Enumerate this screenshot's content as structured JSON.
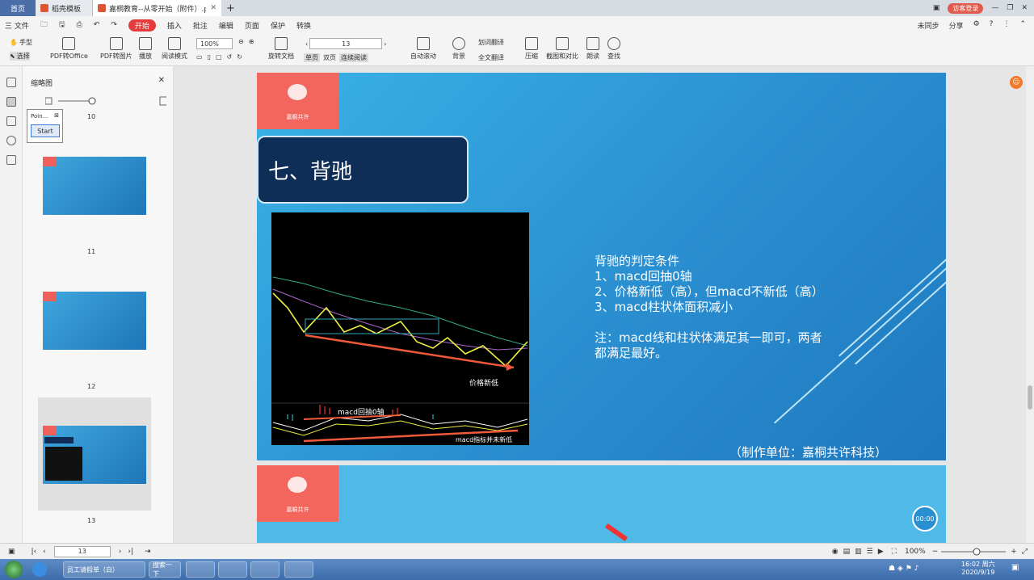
{
  "tabs": {
    "home": "首页",
    "t1": "稻壳模板",
    "t2": "嘉桐教育--从零开始（附件）.pdf"
  },
  "window": {
    "login": "访客登录"
  },
  "menu": {
    "file": "三 文件",
    "start": "开始",
    "insert": "插入",
    "annotate": "批注",
    "edit": "编辑",
    "page": "页面",
    "protect": "保护",
    "convert": "转换",
    "sync": "未同步",
    "share": "分享"
  },
  "toolbar": {
    "hand": "手型",
    "select": "选择",
    "pdf2office": "PDF转Office",
    "pdf2img": "PDF转图片",
    "play": "播放",
    "read": "阅读模式",
    "zoom": "100%",
    "rotate": "旋转文档",
    "page": "13",
    "single": "单页",
    "double": "双页",
    "continuous": "连续阅读",
    "autoscroll": "自动滚动",
    "bg": "背景",
    "translate": "划词翻译",
    "fulltrans": "全文翻译",
    "compress": "压缩",
    "screenshot": "截图和对比",
    "read2": "朗读",
    "find": "查找"
  },
  "panel": {
    "title": "缩略图",
    "pages": [
      "10",
      "11",
      "12",
      "13"
    ]
  },
  "pointer": {
    "title": "Poin...",
    "btn": "Start"
  },
  "slide": {
    "logo_text": "嘉桐共许",
    "title": "七、背驰",
    "lines": [
      "背驰的判定条件",
      "1、macd回抽0轴",
      "2、价格新低（高），但macd不新低（高）",
      "3、macd柱状体面积减小"
    ],
    "note": [
      "注：macd线和柱状体满足其一即可，两者",
      "都满足最好。"
    ],
    "footer": "（制作单位：嘉桐共许科技）",
    "chart_labels": {
      "price": "价格新低",
      "macd0": "macd回抽0轴",
      "macdnew": "macd指标并未新低"
    }
  },
  "player": {
    "time": "00:00"
  },
  "status": {
    "page": "13",
    "zoom": "100%"
  },
  "taskbar": {
    "ie": "员工请假单（白）",
    "search": "搜索一下",
    "time": "16:02 周六",
    "date": "2020/9/19"
  }
}
